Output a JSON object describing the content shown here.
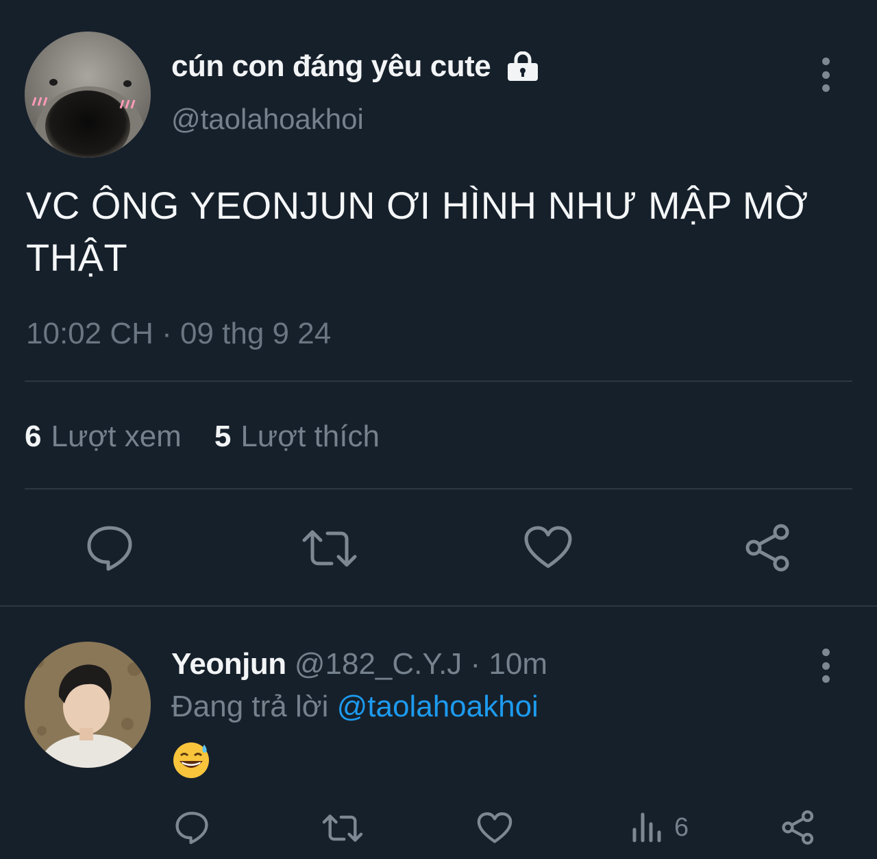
{
  "main_tweet": {
    "display_name": "cún con đáng yêu cute",
    "handle": "@taolahoakhoi",
    "text": "VC ÔNG YEONJUN ƠI HÌNH NHƯ MẬP MỜ THẬT",
    "timestamp": "10:02 CH · 09 thg 9 24",
    "views_count": "6",
    "views_label": "Lượt xem",
    "likes_count": "5",
    "likes_label": "Lượt thích"
  },
  "reply": {
    "display_name": "Yeonjun",
    "handle_time": " @182_C.Y.J · 10m",
    "replying_prefix": "Đang trả lời ",
    "replying_mention": "@taolahoakhoi",
    "emoji": "😅",
    "views": "6"
  },
  "icons": {
    "lock": "lock-icon",
    "more": "more-vertical-icon",
    "reply": "comment-icon",
    "retweet": "retweet-icon",
    "like": "heart-icon",
    "share": "share-icon",
    "views": "bar-chart-icon"
  },
  "colors": {
    "background": "#16202b",
    "muted": "#75818c",
    "accent": "#1d9bf0"
  }
}
